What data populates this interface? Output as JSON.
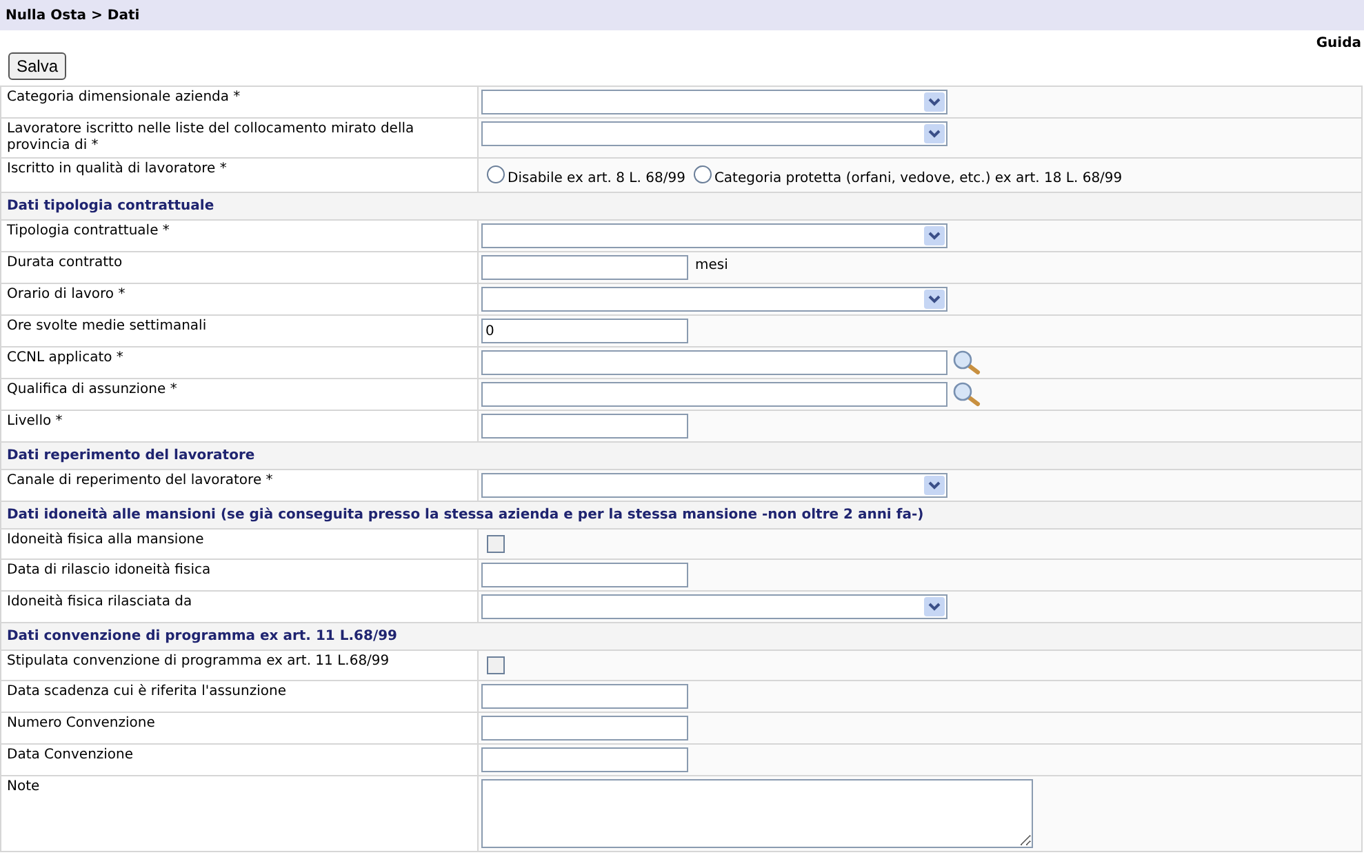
{
  "breadcrumb": "Nulla Osta > Dati",
  "help_link": "Guida",
  "save_button": "Salva",
  "rows": [
    {
      "kind": "select",
      "label": "Categoria dimensionale azienda *"
    },
    {
      "kind": "select",
      "label": "Lavoratore iscritto nelle liste del collocamento mirato della provincia di *"
    },
    {
      "kind": "radio",
      "label": "Iscritto in qualità di lavoratore *",
      "options": [
        {
          "label": "Disabile ex art. 8 L. 68/99",
          "selected": false
        },
        {
          "label": "Categoria protetta (orfani, vedove, etc.) ex art. 18 L. 68/99",
          "selected": false
        }
      ]
    },
    {
      "kind": "section",
      "label": "Dati tipologia contrattuale"
    },
    {
      "kind": "select",
      "label": "Tipologia contrattuale *"
    },
    {
      "kind": "text",
      "label": "Durata contratto",
      "unit": "mesi"
    },
    {
      "kind": "select",
      "label": "Orario di lavoro *"
    },
    {
      "kind": "text",
      "label": "Ore svolte medie settimanali",
      "value": "0"
    },
    {
      "kind": "lookup",
      "label": "CCNL applicato *"
    },
    {
      "kind": "lookup",
      "label": "Qualifica di assunzione *"
    },
    {
      "kind": "text",
      "label": "Livello *"
    },
    {
      "kind": "section",
      "label": "Dati reperimento del lavoratore"
    },
    {
      "kind": "select",
      "label": "Canale di reperimento del lavoratore *"
    },
    {
      "kind": "section",
      "label": "Dati idoneità alle mansioni (se già conseguita presso la stessa azienda e per la stessa mansione -non oltre 2 anni fa-)"
    },
    {
      "kind": "checkbox",
      "label": "Idoneità fisica alla mansione",
      "checked": false
    },
    {
      "kind": "text",
      "label": "Data di rilascio idoneità fisica"
    },
    {
      "kind": "select",
      "label": "Idoneità fisica rilasciata da"
    },
    {
      "kind": "section",
      "label": "Dati convenzione di programma ex art. 11 L.68/99"
    },
    {
      "kind": "checkbox",
      "label": "Stipulata convenzione di programma ex art. 11 L.68/99",
      "checked": false
    },
    {
      "kind": "text",
      "label": "Data scadenza cui è riferita l'assunzione"
    },
    {
      "kind": "text",
      "label": "Numero Convenzione"
    },
    {
      "kind": "text",
      "label": "Data Convenzione"
    },
    {
      "kind": "textarea",
      "label": "Note"
    }
  ]
}
